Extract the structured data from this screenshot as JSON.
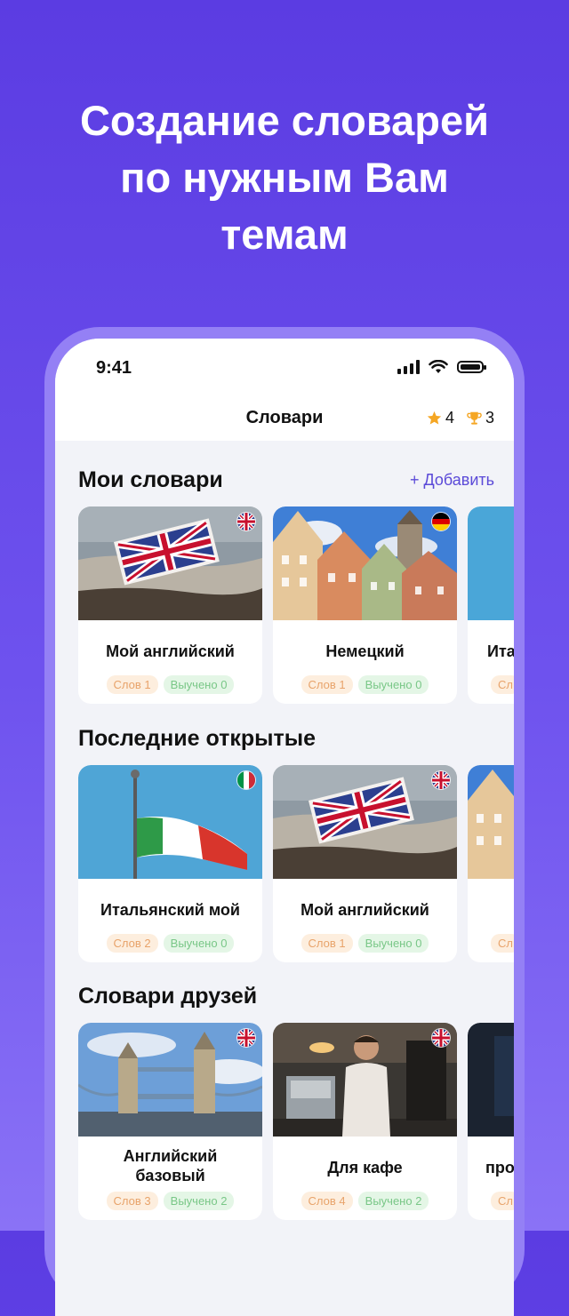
{
  "headline": {
    "line1": "Создание словарей",
    "line2": "по нужным Вам",
    "line3": "темам"
  },
  "status_bar": {
    "time": "9:41"
  },
  "nav": {
    "title": "Словари",
    "stars": "4",
    "trophies": "3"
  },
  "sections": {
    "my": {
      "title": "Мои словари",
      "add_label": "+ Добавить",
      "cards": [
        {
          "name": "Мой английский",
          "words": "Слов 1",
          "learned": "Выучено 0",
          "flag": "uk-flag-icon",
          "image": "london-card-sand"
        },
        {
          "name": "Немецкий",
          "words": "Слов 1",
          "learned": "Выучено 0",
          "flag": "germany-flag-icon",
          "image": "german-houses"
        },
        {
          "name": "Ита",
          "words": "Сл",
          "learned": "",
          "flag": "",
          "image": "blue-sky"
        }
      ]
    },
    "recent": {
      "title": "Последние открытые",
      "cards": [
        {
          "name": "Итальянский мой",
          "words": "Слов 2",
          "learned": "Выучено 0",
          "flag": "italy-flag-icon",
          "image": "italian-flag"
        },
        {
          "name": "Мой английский",
          "words": "Слов 1",
          "learned": "Выучено 0",
          "flag": "uk-flag-icon",
          "image": "london-card-sand"
        },
        {
          "name": "",
          "words": "Сл",
          "learned": "",
          "flag": "",
          "image": "german-houses"
        }
      ]
    },
    "friends": {
      "title": "Словари друзей",
      "cards": [
        {
          "name": "Английский базовый",
          "words": "Слов 3",
          "learned": "Выучено 2",
          "flag": "uk-flag-icon",
          "image": "tower-bridge"
        },
        {
          "name": "Для кафе",
          "words": "Слов 4",
          "learned": "Выучено 2",
          "flag": "uk-flag-icon",
          "image": "barista"
        },
        {
          "name": "про",
          "words": "Сл",
          "learned": "",
          "flag": "",
          "image": "dark-screen"
        }
      ]
    }
  },
  "colors": {
    "background": "#5b3ce2",
    "accent": "#5b4ad8",
    "words_badge": "#fdeede",
    "learned_badge": "#e4f6e6"
  }
}
